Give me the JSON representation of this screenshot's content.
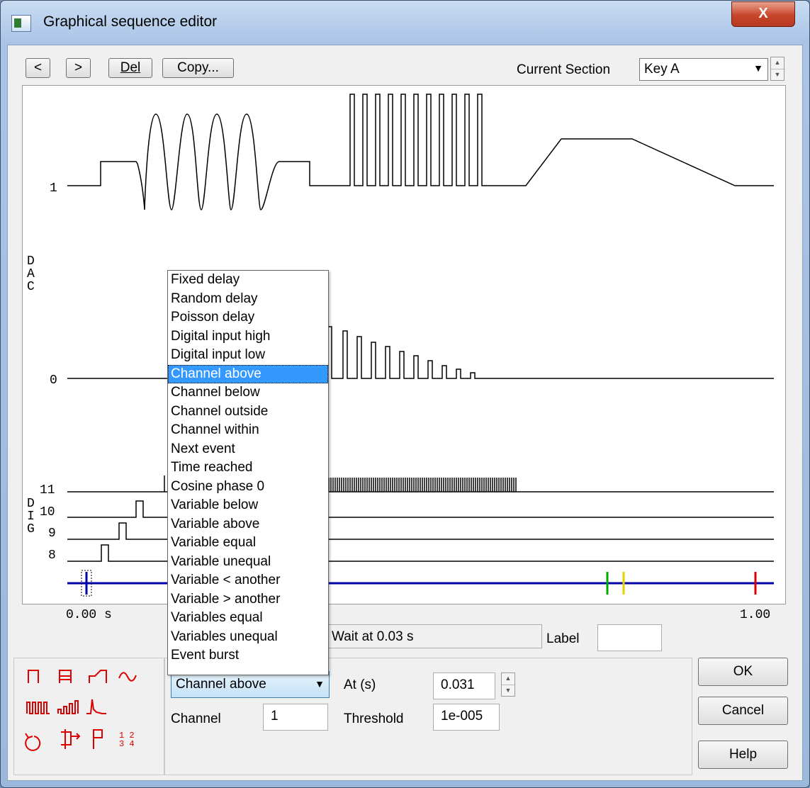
{
  "window": {
    "title": "Graphical sequence editor",
    "close_label": "X"
  },
  "toolbar": {
    "prev_label": "<",
    "next_label": ">",
    "del_label": "Del",
    "copy_label": "Copy...",
    "section_label": "Current Section",
    "section_value": "Key A"
  },
  "graph": {
    "dac_letters": [
      "D",
      "A",
      "C"
    ],
    "dig_letters": [
      "D",
      "I",
      "G"
    ],
    "dac_level_1": "1",
    "dac_level_0": "0",
    "dig_channels": [
      "11",
      "10",
      "9",
      "8"
    ],
    "time_start": "0.00 s",
    "time_end": "1.00"
  },
  "status": {
    "step_text": "Wait at 0.03 s",
    "label_label": "Label",
    "label_value": ""
  },
  "palette_icons": [
    "pulse-icon",
    "pulse-train-icon",
    "ramp-icon",
    "sine-icon",
    "square-train-icon",
    "varying-train-icon",
    "arbitrary-icon",
    "loop-icon",
    "branch-icon",
    "flag-icon",
    "counter-icon"
  ],
  "params": {
    "condition_value": "Channel above",
    "at_label": "At (s)",
    "at_value": "0.031",
    "channel_label": "Channel",
    "channel_value": "1",
    "threshold_label": "Threshold",
    "threshold_value": "1e-005"
  },
  "dropdown": {
    "items": [
      "Fixed delay",
      "Random delay",
      "Poisson delay",
      "Digital input high",
      "Digital input low",
      "Channel above",
      "Channel below",
      "Channel outside",
      "Channel within",
      "Next event",
      "Time reached",
      "Cosine phase 0",
      "Variable below",
      "Variable above",
      "Variable equal",
      "Variable unequal",
      "Variable < another",
      "Variable > another",
      "Variables equal",
      "Variables unequal",
      "Event burst"
    ],
    "selected": "Channel above"
  },
  "dialog_buttons": {
    "ok": "OK",
    "cancel": "Cancel",
    "help": "Help"
  },
  "colors": {
    "timeline": "#0000aa",
    "marker_green": "#00aa00",
    "marker_yellow": "#e6d200",
    "marker_red": "#dd0000",
    "palette_icon": "#dd0000",
    "selection": "#3399ff"
  }
}
